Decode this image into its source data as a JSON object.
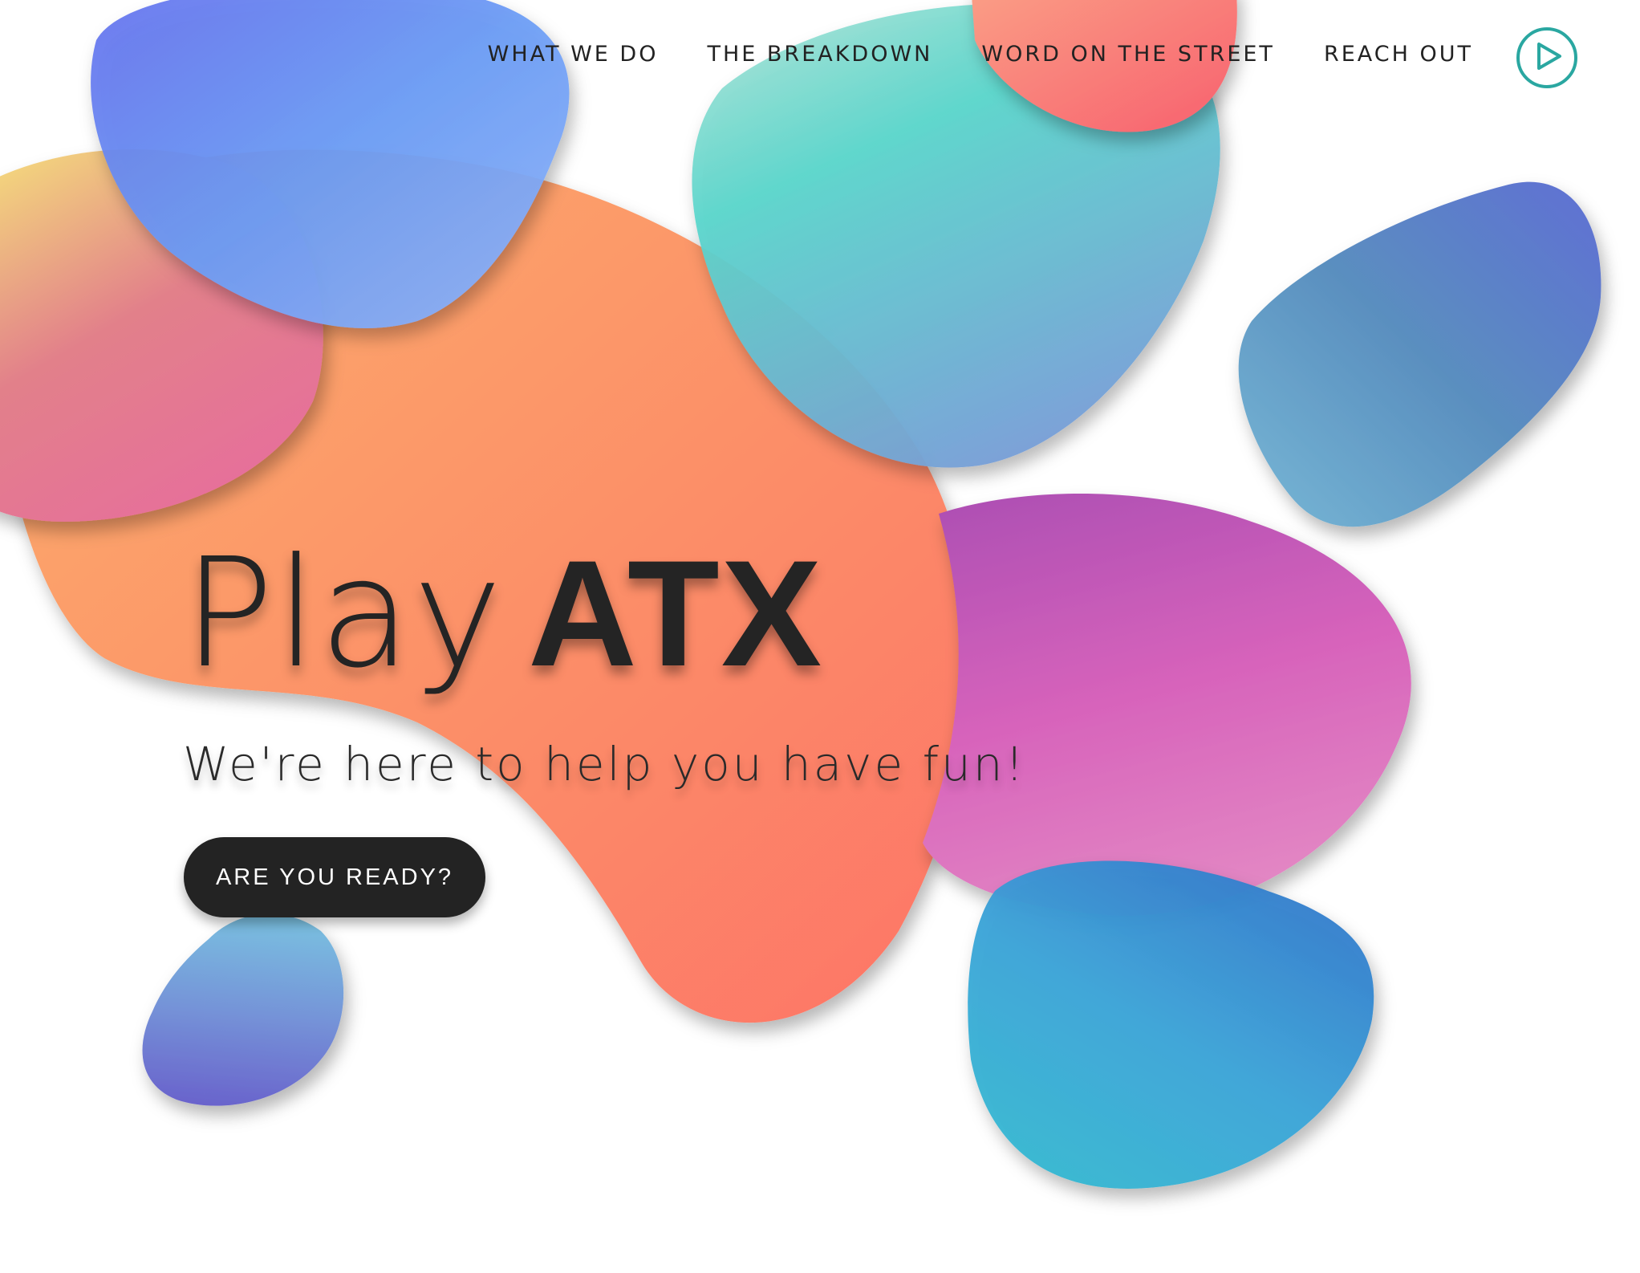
{
  "nav": {
    "items": [
      {
        "label": "WHAT WE DO"
      },
      {
        "label": "THE BREAKDOWN"
      },
      {
        "label": "WORD ON THE STREET"
      },
      {
        "label": "REACH OUT"
      }
    ],
    "play_icon": "play-circle-icon",
    "accent_color": "#2aa7a1"
  },
  "hero": {
    "title_light": "Play",
    "title_bold": "ATX",
    "subtitle": "We're here to help you have fun!",
    "cta_label": "ARE YOU READY?"
  },
  "colors": {
    "text": "#242424",
    "button_bg": "#232323",
    "button_text": "#ffffff",
    "background": "#ffffff"
  }
}
